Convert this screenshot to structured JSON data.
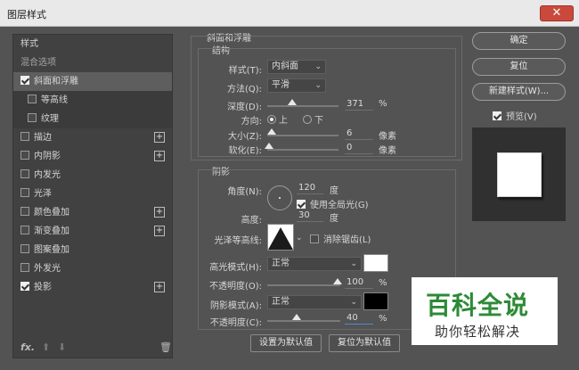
{
  "window": {
    "title": "图层样式",
    "close_glyph": "✕"
  },
  "left_list": {
    "items": [
      {
        "label": "样式",
        "checkbox": false,
        "checked": false,
        "plus": false,
        "style": "plain"
      },
      {
        "label": "混合选项",
        "checkbox": false,
        "checked": false,
        "plus": false,
        "style": "dim"
      },
      {
        "label": "斜面和浮雕",
        "checkbox": true,
        "checked": true,
        "plus": false,
        "style": "selected"
      },
      {
        "label": "等高线",
        "checkbox": true,
        "checked": false,
        "plus": false,
        "style": "sub"
      },
      {
        "label": "纹理",
        "checkbox": true,
        "checked": false,
        "plus": false,
        "style": "sub"
      },
      {
        "label": "描边",
        "checkbox": true,
        "checked": false,
        "plus": true,
        "style": "plain"
      },
      {
        "label": "内阴影",
        "checkbox": true,
        "checked": false,
        "plus": true,
        "style": "plain"
      },
      {
        "label": "内发光",
        "checkbox": true,
        "checked": false,
        "plus": false,
        "style": "plain"
      },
      {
        "label": "光泽",
        "checkbox": true,
        "checked": false,
        "plus": false,
        "style": "plain"
      },
      {
        "label": "颜色叠加",
        "checkbox": true,
        "checked": false,
        "plus": true,
        "style": "plain"
      },
      {
        "label": "渐变叠加",
        "checkbox": true,
        "checked": false,
        "plus": true,
        "style": "plain"
      },
      {
        "label": "图案叠加",
        "checkbox": true,
        "checked": false,
        "plus": false,
        "style": "plain"
      },
      {
        "label": "外发光",
        "checkbox": true,
        "checked": false,
        "plus": false,
        "style": "plain"
      },
      {
        "label": "投影",
        "checkbox": true,
        "checked": true,
        "plus": true,
        "style": "plain"
      }
    ],
    "footer": {
      "fx": "fx.",
      "up": "⬆",
      "down": "⬇",
      "trash": "🗑"
    }
  },
  "bevel": {
    "section_title": "斜面和浮雕",
    "structure_title": "结构",
    "style_label": "样式(T):",
    "style_value": "内斜面",
    "technique_label": "方法(Q):",
    "technique_value": "平滑",
    "depth_label": "深度(D):",
    "depth_value": "371",
    "depth_unit": "%",
    "depth_frac": 0.25,
    "direction_label": "方向:",
    "direction_up": "上",
    "direction_down": "下",
    "size_label": "大小(Z):",
    "size_value": "6",
    "size_unit": "像素",
    "size_frac": 0.03,
    "soften_label": "软化(E):",
    "soften_value": "0",
    "soften_unit": "像素",
    "soften_frac": 0.0
  },
  "shading": {
    "title": "阴影",
    "angle_label": "角度(N):",
    "angle_value": "120",
    "angle_unit": "度",
    "global_light_label": "使用全局光(G)",
    "altitude_label": "高度:",
    "altitude_value": "30",
    "altitude_unit": "度",
    "gloss_label": "光泽等高线:",
    "antialias_label": "消除锯齿(L)",
    "highlight_mode_label": "高光模式(H):",
    "highlight_mode_value": "正常",
    "highlight_color": "#ffffff",
    "highlight_opacity_label": "不透明度(O):",
    "highlight_opacity_value": "100",
    "highlight_opacity_unit": "%",
    "highlight_opacity_frac": 1.0,
    "shadow_mode_label": "阴影模式(A):",
    "shadow_mode_value": "正常",
    "shadow_color": "#000000",
    "shadow_opacity_label": "不透明度(C):",
    "shadow_opacity_value": "40",
    "shadow_opacity_unit": "%",
    "shadow_opacity_frac": 0.4
  },
  "bottom_buttons": {
    "set_default": "设置为默认值",
    "reset_default": "复位为默认值"
  },
  "right_buttons": {
    "ok": "确定",
    "reset": "复位",
    "new_style": "新建样式(W)...",
    "preview_label": "预览(V)"
  },
  "watermark": {
    "main": "百科全说",
    "sub": "助你轻松解决"
  }
}
